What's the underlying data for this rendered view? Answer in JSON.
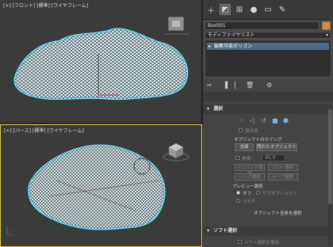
{
  "viewport_top": {
    "label": "[+] [フロント] [標準] [ワイヤフレーム]"
  },
  "viewport_persp": {
    "label": "[+] [パース] [標準] [ワイヤフレーム]"
  },
  "command_panel": {
    "tabs": [
      {
        "icon": "create-icon",
        "glyph": "＋"
      },
      {
        "icon": "modify-icon",
        "glyph": "◩"
      },
      {
        "icon": "hierarchy-icon",
        "glyph": "⊞"
      },
      {
        "icon": "motion-icon",
        "glyph": "●"
      },
      {
        "icon": "display-icon",
        "glyph": "▭"
      },
      {
        "icon": "utilities-icon",
        "glyph": "✎"
      }
    ],
    "object_name": "Box001",
    "object_color": "#d98a3c",
    "modifier_list_label": "モディファイヤリスト",
    "stack_items": [
      {
        "label": "編集可能ポリゴン"
      }
    ]
  },
  "selection": {
    "header": "選択",
    "by_vertex": "頂点別",
    "ignore_backfacing": "",
    "options_title": "オブジェクトのカリング",
    "full_button": "全面",
    "hide_button": "隠れたオブジェクト",
    "angle_label": "角度：",
    "angle_value": "45.0",
    "shrink_button": "シュリンク選択",
    "grow_button": "グロー選択",
    "ring_button": "リング選択",
    "loop_button": "ループ選択",
    "preview_title": "プレビュー選択",
    "preview_off": "オフ",
    "preview_subobject": "サブオブジェクト",
    "preview_multi": "マルチ",
    "whole_object": "オブジェクト全体を選択"
  },
  "soft_selection": {
    "header": "ソフト選択",
    "use_soft": "ソフト選択を使用"
  },
  "colors": {
    "accent": "#e8c84a",
    "selection_blue": "#4d6a8a",
    "wire_glow": "#7fe8ff"
  }
}
